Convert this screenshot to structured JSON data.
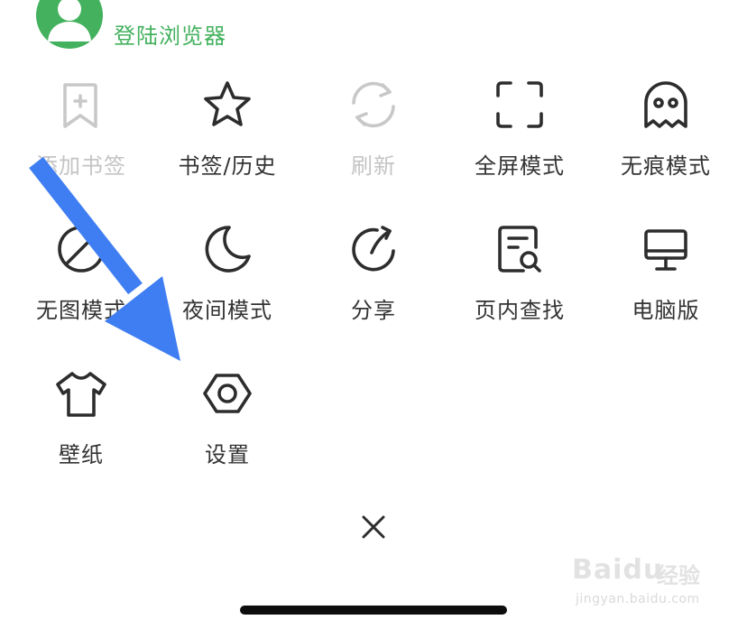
{
  "header": {
    "login_label": "登陆浏览器"
  },
  "menu": [
    {
      "id": "add-bookmark",
      "label": "添加书签",
      "icon": "bookmark-plus-icon",
      "disabled": true
    },
    {
      "id": "bookmarks-history",
      "label": "书签/历史",
      "icon": "star-icon",
      "disabled": false
    },
    {
      "id": "refresh",
      "label": "刷新",
      "icon": "refresh-icon",
      "disabled": true
    },
    {
      "id": "fullscreen",
      "label": "全屏模式",
      "icon": "fullscreen-icon",
      "disabled": false
    },
    {
      "id": "incognito",
      "label": "无痕模式",
      "icon": "ghost-icon",
      "disabled": false
    },
    {
      "id": "no-image",
      "label": "无图模式",
      "icon": "no-image-icon",
      "disabled": false
    },
    {
      "id": "night",
      "label": "夜间模式",
      "icon": "moon-icon",
      "disabled": false
    },
    {
      "id": "share",
      "label": "分享",
      "icon": "share-icon",
      "disabled": false
    },
    {
      "id": "find-in-page",
      "label": "页内查找",
      "icon": "find-in-page-icon",
      "disabled": false
    },
    {
      "id": "desktop",
      "label": "电脑版",
      "icon": "monitor-icon",
      "disabled": false
    },
    {
      "id": "wallpaper",
      "label": "壁纸",
      "icon": "tshirt-icon",
      "disabled": false
    },
    {
      "id": "settings",
      "label": "设置",
      "icon": "hexagon-nut-icon",
      "disabled": false
    }
  ],
  "close_icon": "close-icon",
  "colors": {
    "brand_green": "#43b15d",
    "arrow_blue": "#3f7ef2",
    "disabled_gray": "#c4c4c4"
  },
  "watermark": {
    "brand": "Baidu",
    "brand_cn": "经验",
    "url": "jingyan.baidu.com"
  }
}
